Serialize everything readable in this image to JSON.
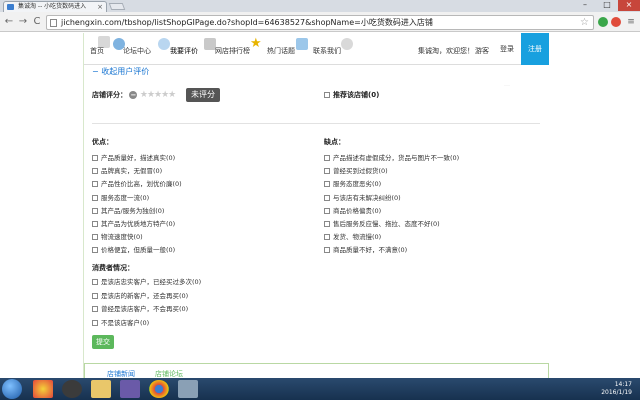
{
  "browser": {
    "tab_title": "集诚淘 -- 小吃货数码进入",
    "tab_close": "×",
    "url": "jichengxin.com/tbshop/listShopGIPage.do?shopId=64638527&shopName=小吃货数码进入店铺",
    "back": "←",
    "forward": "→",
    "reload": "C",
    "window_min": "–",
    "window_max": "□",
    "window_close": "×"
  },
  "nav": {
    "home": "首页",
    "forum": "论坛中心",
    "my_reviews": "我要评价",
    "ranking": "网店排行榜",
    "hot_topics": "热门话题",
    "contact": "联系我们",
    "welcome": "集诚淘，欢迎您！",
    "guest": "游客",
    "login": "登录",
    "register": "注册"
  },
  "form": {
    "collapse_label": "收起用户评价",
    "rating_label": "店铺评分：",
    "unrated": "未评分",
    "recommend_label": "推荐该店铺(0)",
    "pros_title": "优点：",
    "cons_title": "缺点：",
    "consumer_title": "消费者情况：",
    "pros": [
      "产品质量好，描述真实(0)",
      "品牌真实，无假冒(0)",
      "产品性价比高，划优价廉(0)",
      "服务态度一流(0)",
      "其产品/服务为独创(0)",
      "其产品为优质地方特产(0)",
      "物流速度快(0)",
      "价格便宜，但质量一般(0)"
    ],
    "cons": [
      "产品描述有虚假成分，货品与图片不一致(0)",
      "曾经买到过假货(0)",
      "服务态度恶劣(0)",
      "与该店有未解决纠纷(0)",
      "商品价格偏贵(0)",
      "售后服务反应慢、拖拉、态度不好(0)",
      "发货、物流慢(0)",
      "商品质量不好，不满意(0)"
    ],
    "consumer": [
      "是该店忠实客户，已经买过多次(0)",
      "是该店的新客户，还会再买(0)",
      "曾经是该店客户，不会再买(0)",
      "不是该店客户(0)"
    ],
    "submit": "提交"
  },
  "bottom_tabs": {
    "shop_news": "店铺新闻",
    "shop_forum": "店铺论坛"
  },
  "taskbar": {
    "time": "14:17",
    "date": "2016/1/19"
  }
}
